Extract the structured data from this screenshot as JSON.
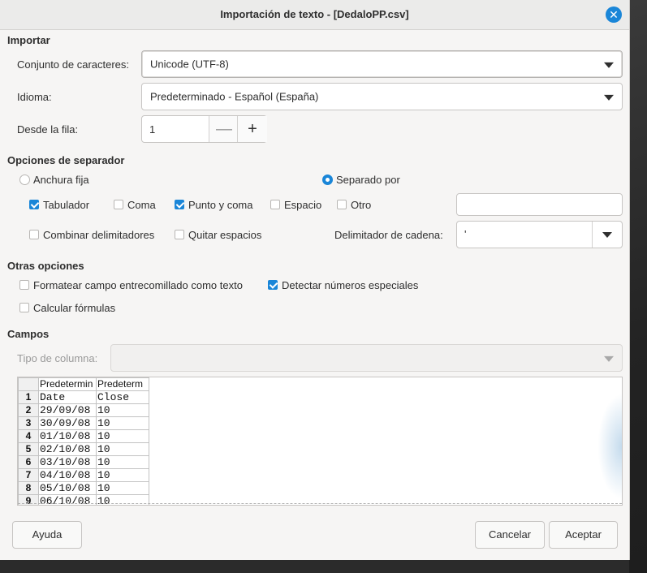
{
  "window": {
    "title": "Importación de texto - [DedaloPP.csv]"
  },
  "import": {
    "section": "Importar",
    "charset_label": "Conjunto de caracteres:",
    "charset_value": "Unicode (UTF-8)",
    "language_label": "Idioma:",
    "language_value": "Predeterminado - Español (España)",
    "from_row_label": "Desde la fila:",
    "from_row_value": "1"
  },
  "separator": {
    "section": "Opciones de separador",
    "fixed_width": "Anchura fija",
    "separated_by": "Separado por",
    "tab": "Tabulador",
    "comma": "Coma",
    "semicolon": "Punto y coma",
    "space": "Espacio",
    "other": "Otro",
    "merge": "Combinar delimitadores",
    "trim": "Quitar espacios",
    "string_delim_label": "Delimitador de cadena:",
    "string_delim_value": "'"
  },
  "other_options": {
    "section": "Otras opciones",
    "quoted_as_text": "Formatear campo entrecomillado como texto",
    "detect_special": "Detectar números especiales",
    "evaluate_formulas": "Calcular fórmulas"
  },
  "fields": {
    "section": "Campos",
    "column_type_label": "Tipo de columna:",
    "headers": [
      "Predetermin",
      "Predeterm"
    ],
    "rows": [
      [
        "1",
        "Date",
        "Close"
      ],
      [
        "2",
        "29/09/08",
        "10"
      ],
      [
        "3",
        "30/09/08",
        "10"
      ],
      [
        "4",
        "01/10/08",
        "10"
      ],
      [
        "5",
        "02/10/08",
        "10"
      ],
      [
        "6",
        "03/10/08",
        "10"
      ],
      [
        "7",
        "04/10/08",
        "10"
      ],
      [
        "8",
        "05/10/08",
        "10"
      ],
      [
        "9",
        "06/10/08",
        "10"
      ]
    ]
  },
  "buttons": {
    "help": "Ayuda",
    "cancel": "Cancelar",
    "accept": "Aceptar"
  },
  "colors": {
    "accent": "#1a86d8",
    "dialog_bg": "#f6f5f4"
  }
}
